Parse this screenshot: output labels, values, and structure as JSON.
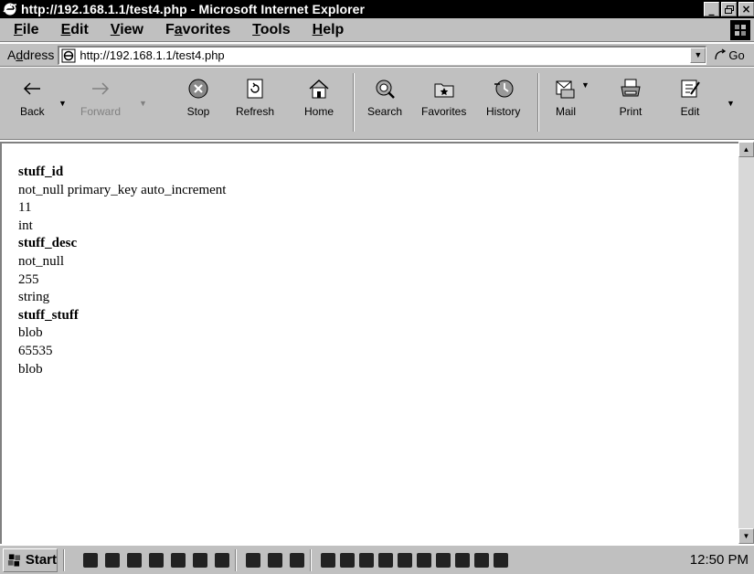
{
  "window": {
    "title": "http://192.168.1.1/test4.php - Microsoft Internet Explorer",
    "minimize": "_",
    "maximize": "▫",
    "close": "×"
  },
  "menu": {
    "items": [
      {
        "pre": "",
        "u": "F",
        "post": "ile"
      },
      {
        "pre": "",
        "u": "E",
        "post": "dit"
      },
      {
        "pre": "",
        "u": "V",
        "post": "iew"
      },
      {
        "pre": "F",
        "u": "a",
        "post": "vorites"
      },
      {
        "pre": "",
        "u": "T",
        "post": "ools"
      },
      {
        "pre": "",
        "u": "H",
        "post": "elp"
      }
    ]
  },
  "address": {
    "label_pre": "A",
    "label_u": "d",
    "label_post": "dress",
    "url": "http://192.168.1.1/test4.php",
    "go_label": "Go"
  },
  "toolbar": {
    "back": "Back",
    "forward": "Forward",
    "stop": "Stop",
    "refresh": "Refresh",
    "home": "Home",
    "search": "Search",
    "favorites": "Favorites",
    "history": "History",
    "mail": "Mail",
    "print": "Print",
    "edit": "Edit"
  },
  "page": {
    "lines": [
      {
        "text": "stuff_id",
        "bold": true
      },
      {
        "text": "not_null primary_key auto_increment",
        "bold": false
      },
      {
        "text": "11",
        "bold": false
      },
      {
        "text": "int",
        "bold": false
      },
      {
        "text": "stuff_desc",
        "bold": true
      },
      {
        "text": "not_null",
        "bold": false
      },
      {
        "text": "255",
        "bold": false
      },
      {
        "text": "string",
        "bold": false
      },
      {
        "text": "stuff_stuff",
        "bold": true
      },
      {
        "text": "blob",
        "bold": false
      },
      {
        "text": "65535",
        "bold": false
      },
      {
        "text": "blob",
        "bold": false
      }
    ]
  },
  "taskbar": {
    "start_label": "Start",
    "clock": "12:50 PM"
  },
  "colors": {
    "titlebar": "#000000",
    "chrome": "#c0c0c0"
  }
}
